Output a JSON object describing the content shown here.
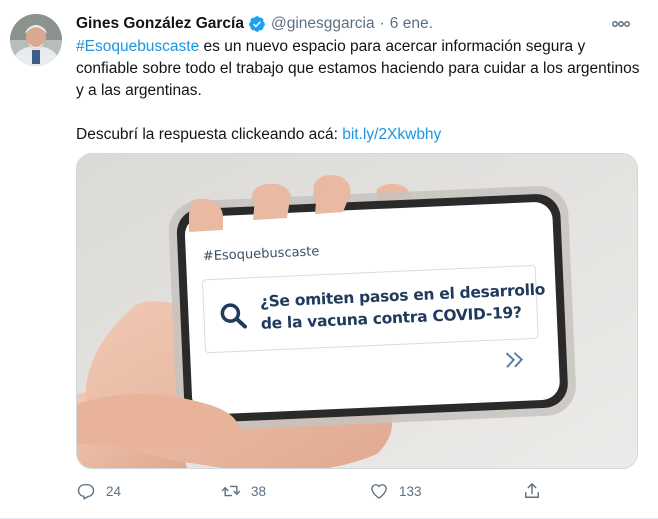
{
  "author": {
    "name": "Gines González García",
    "handle": "@ginesggarcia",
    "separator": "·",
    "date": "6 ene."
  },
  "tweet": {
    "hashtag": "#Esoquebuscaste",
    "text_line1_rest": " es un nuevo espacio para acercar información segura y confiable sobre todo el trabajo que estamos haciendo para cuidar a los argentinos y a las argentinas.",
    "cta_text": "Descubrí la respuesta clickeando acá: ",
    "link": "bit.ly/2Xkwbhy"
  },
  "media": {
    "phone_hashtag": "#Esoquebuscaste",
    "question_line1": "¿Se omiten pasos en el desarrollo",
    "question_line2": "de la vacuna contra COVID-19?"
  },
  "actions": {
    "reply_count": "24",
    "retweet_count": "38",
    "like_count": "133"
  },
  "icons": {
    "verified": "verified-badge-icon",
    "more": "more-options-icon",
    "reply": "reply-icon",
    "retweet": "retweet-icon",
    "like": "heart-icon",
    "share": "share-icon",
    "search": "search-icon",
    "chevrons": "double-chevron-right-icon"
  },
  "colors": {
    "link": "#1b95e0",
    "secondary_text": "#5b7083",
    "verified": "#1da1f2",
    "phone_question": "#1f3a5c"
  }
}
